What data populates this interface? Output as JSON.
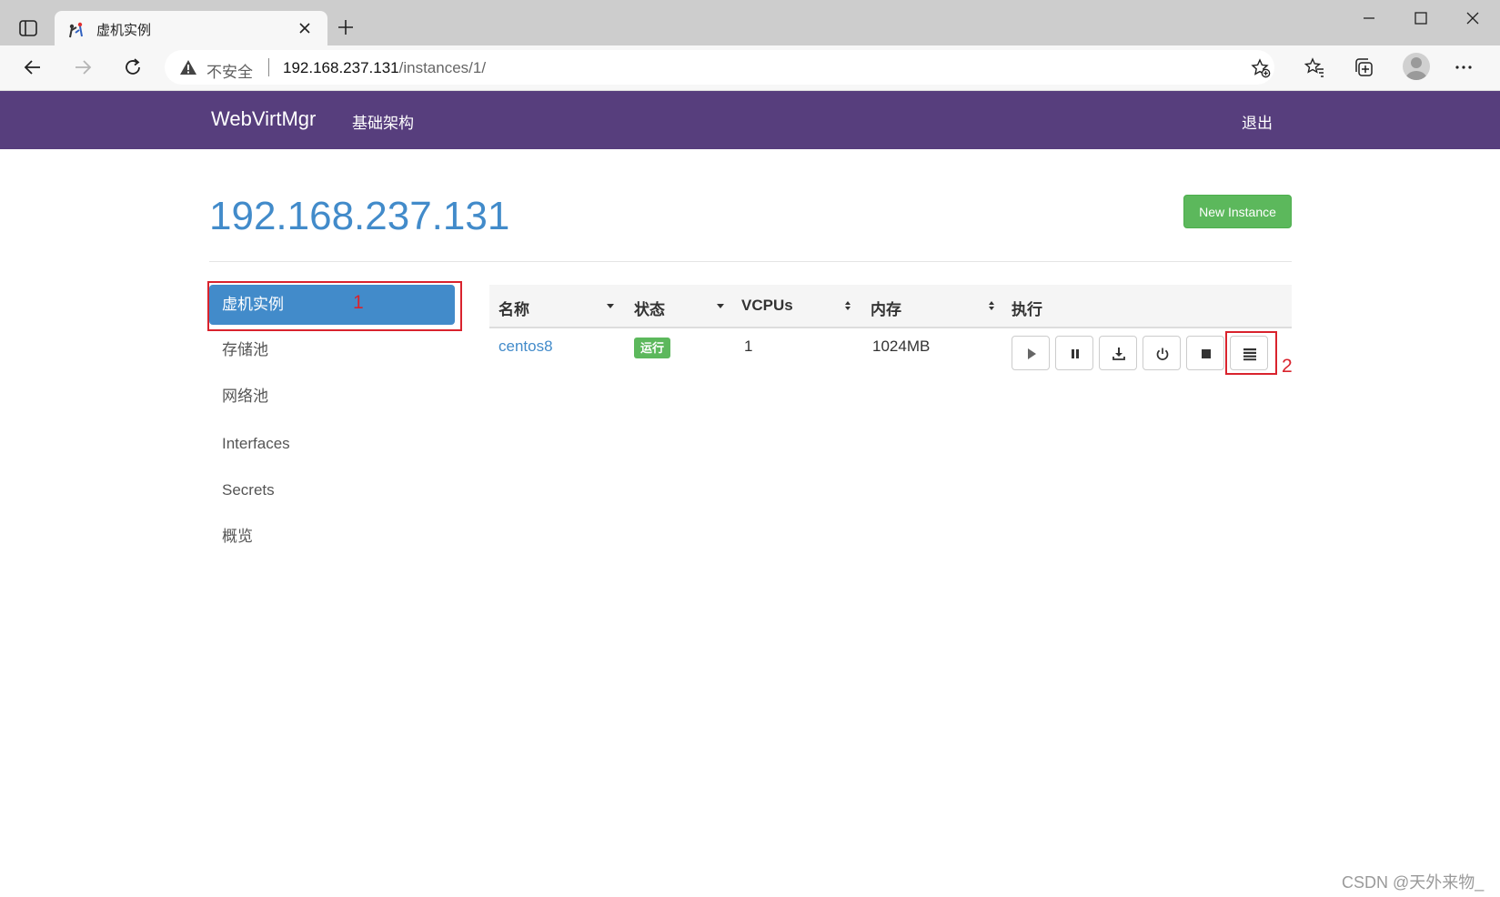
{
  "browser": {
    "tab_title": "虚机实例",
    "insecure_label": "不安全",
    "url_host": "192.168.237.131",
    "url_path": "/instances/1/",
    "icons": [
      "sidebar-toggle-icon",
      "favicon-icon",
      "close-icon",
      "plus-icon",
      "minimize-icon",
      "maximize-icon",
      "close-window-icon",
      "back-arrow-icon",
      "forward-arrow-icon",
      "reload-icon",
      "warning-icon",
      "add-favorite-icon",
      "favorites-icon",
      "collections-icon",
      "profile-icon",
      "more-icon"
    ]
  },
  "navbar": {
    "brand": "WebVirtMgr",
    "infrastructure_link": "基础架构",
    "logout": "退出",
    "color": "#573e7d"
  },
  "page": {
    "title": "192.168.237.131",
    "new_instance_label": "New Instance",
    "title_color": "#428bca",
    "button_color": "#5cb85c"
  },
  "sidebar": {
    "items": [
      {
        "label": "虚机实例",
        "active": true
      },
      {
        "label": "存储池",
        "active": false
      },
      {
        "label": "网络池",
        "active": false
      },
      {
        "label": "Interfaces",
        "active": false
      },
      {
        "label": "Secrets",
        "active": false
      },
      {
        "label": "概览",
        "active": false
      }
    ]
  },
  "table": {
    "headers": [
      "名称",
      "状态",
      "VCPUs",
      "内存",
      "执行"
    ],
    "rows": [
      {
        "name": "centos8",
        "status": "运行",
        "vcpus": "1",
        "memory": "1024MB",
        "actions": [
          "play-icon",
          "pause-icon",
          "download-icon",
          "power-icon",
          "stop-icon",
          "list-icon"
        ]
      }
    ]
  },
  "annotations": [
    "1",
    "2"
  ],
  "watermark": "CSDN @天外来物_"
}
